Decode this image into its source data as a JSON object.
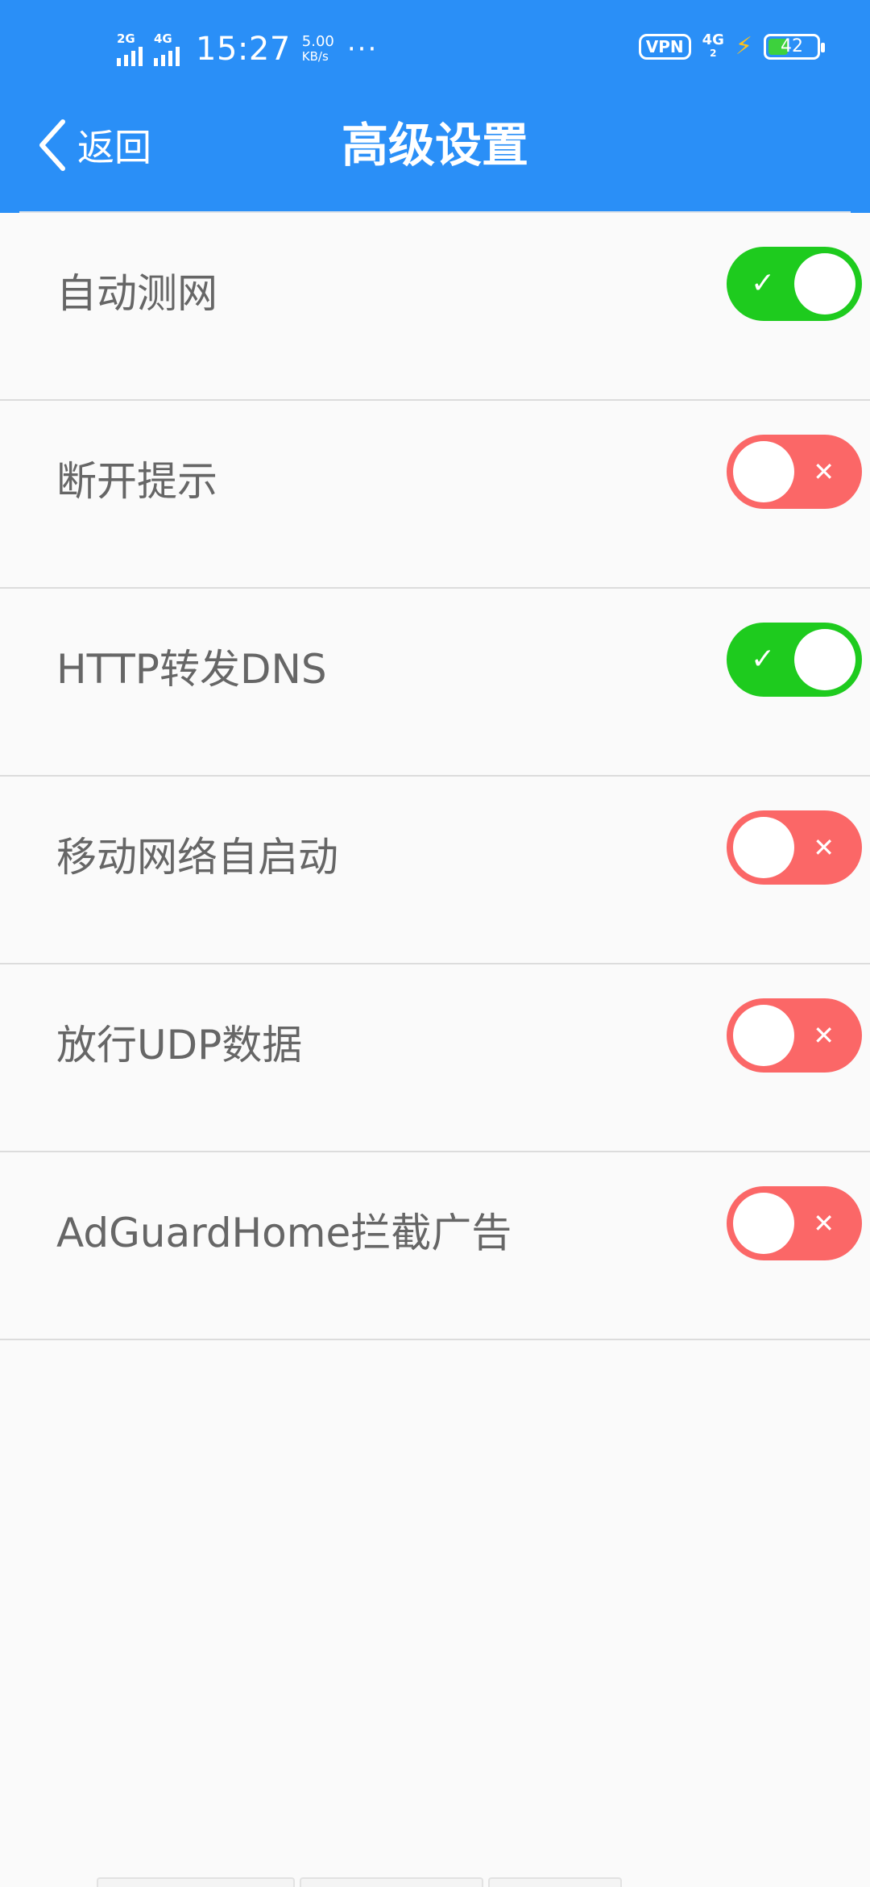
{
  "status_bar": {
    "signal1_label": "2G",
    "signal2_label": "4G",
    "time": "15:27",
    "speed_value": "5.00",
    "speed_unit": "KB/s",
    "more": "···",
    "vpn": "VPN",
    "network": "4G",
    "network_sub": "2",
    "battery": "42",
    "battery_level": 0.42,
    "charging_icon": "bolt-icon"
  },
  "nav": {
    "back_label": "返回",
    "title": "高级设置",
    "back_icon": "chevron-left-icon"
  },
  "settings": [
    {
      "label": "自动测网",
      "enabled": true
    },
    {
      "label": "断开提示",
      "enabled": false
    },
    {
      "label": "HTTP转发DNS",
      "enabled": true
    },
    {
      "label": "移动网络自启动",
      "enabled": false
    },
    {
      "label": "放行UDP数据",
      "enabled": false
    },
    {
      "label": "AdGuardHome拦截广告",
      "enabled": false
    }
  ],
  "colors": {
    "header": "#2a8ff7",
    "toggle_on": "#1ecb1e",
    "toggle_off": "#fb6767",
    "charging": "#ffc21a"
  },
  "toggle_marks": {
    "on": "✓",
    "off": "✕"
  }
}
